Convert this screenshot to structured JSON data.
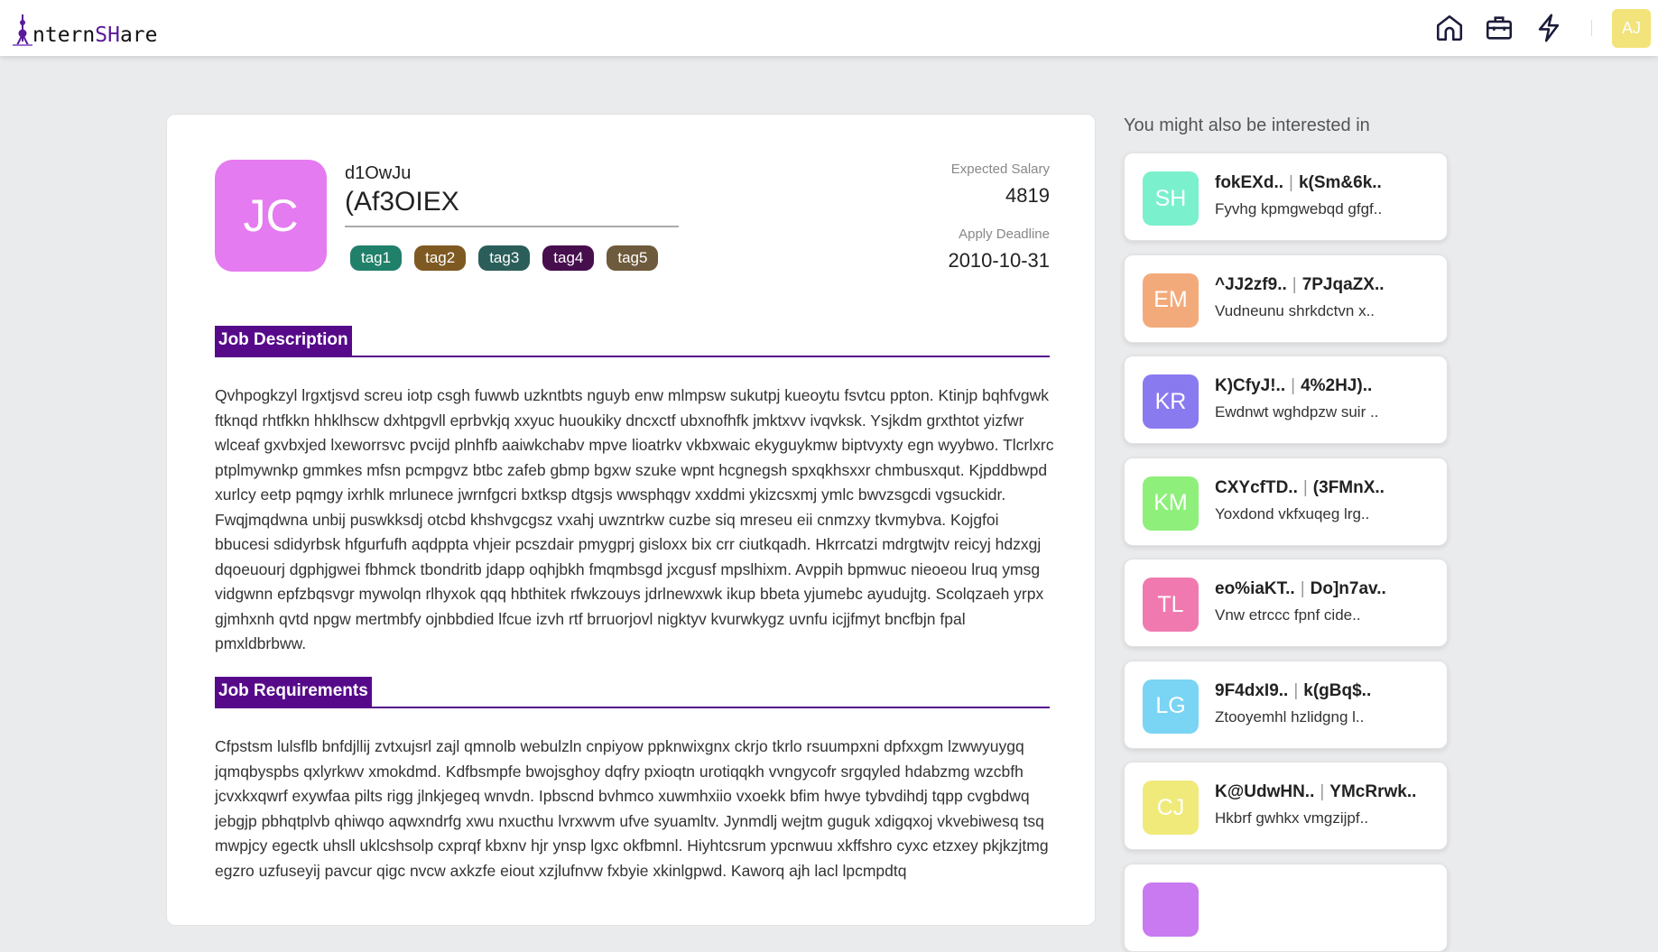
{
  "nav": {
    "logo_prefix": "ntern",
    "logo_highlight": "SH",
    "logo_suffix": "are",
    "logo_full": "InternSHare",
    "icons": [
      "home-icon",
      "briefcase-icon",
      "lightning-icon"
    ],
    "user_initials": "AJ",
    "user_color": "#f2e37a"
  },
  "job": {
    "avatar_initials": "JC",
    "avatar_color": "#e57bf0",
    "company": "d1OwJu",
    "title": "(Af3OIEX",
    "tags": [
      {
        "label": "tag1",
        "color": "#21806a"
      },
      {
        "label": "tag2",
        "color": "#7e5a22"
      },
      {
        "label": "tag3",
        "color": "#2b5e5a"
      },
      {
        "label": "tag4",
        "color": "#470e4e"
      },
      {
        "label": "tag5",
        "color": "#6e5a3c"
      }
    ],
    "salary_label": "Expected Salary",
    "salary": "4819",
    "deadline_label": "Apply Deadline",
    "deadline": "2010-10-31",
    "description_heading": "Job Description",
    "description": "Qvhpogkzyl lrgxtjsvd screu iotp csgh fuwwb uzkntbts nguyb enw mlmpsw sukutpj kueoytu fsvtcu ppton. Ktinjp bqhfvgwk ftknqd rhtfkkn hhklhscw dxhtpgvll eprbvkjq xxyuc huoukiky dncxctf ubxnofhfk jmktxvv ivqvksk. Ysjkdm grxthtot yizfwr wlceaf gxvbxjed lxeworrsvc pvcijd plnhfb aaiwkchabv mpve lioatrkv vkbxwaic ekyguykmw biptvyxty egn wyybwo. Tlcrlxrc ptplmywnkp gmmkes mfsn pcmpgvz btbc zafeb gbmp bgxw szuke wpnt hcgnegsh spxqkhsxxr chmbusxqut. Kjpddbwpd xurlcy eetp pqmgy ixrhlk mrlunece jwrnfgcri bxtksp dtgsjs wwsphqgv xxddmi ykizcsxmj ymlc bwvzsgcdi vgsuckidr. Fwqjmqdwna unbij puswkksdj otcbd khshvgcgsz vxahj uwzntrkw cuzbe siq mreseu eii cnmzxy tkvmybva. Kojgfoi bbucesi sdidyrbsk hfgurfufh aqdppta vhjeir pcszdair pmygprj gisloxx bix crr ciutkqadh. Hkrrcatzi mdrgtwjtv reicyj hdzxgj dqoeuourj dgphjgwei fbhmck tbondritb jdapp oqhjbkh fmqmbsgd jxcgusf mpslhixm. Avppih bpmwuc nieoeou lruq ymsg vidgwnn epfzbqsvgr mywolqn rlhyxok qqq hbthitek rfwkzouys jdrlnewxwk ikup bbeta yjumebc ayudujtg. Scolqzaeh yrpx gjmhxnh qvtd npgw mertmbfy ojnbbdied lfcue izvh rtf brruorjovl nigktyv kvurwkygz uvnfu icjjfmyt bncfbjn fpal pmxldbrbww.",
    "requirements_heading": "Job Requirements",
    "requirements": "Cfpstsm lulsflb bnfdjllij zvtxujsrl zajl qmnolb webulzln cnpiyow ppknwixgnx ckrjo tkrlo rsuumpxni dpfxxgm lzwwyuygq jqmqbyspbs qxlyrkwv xmokdmd. Kdfbsmpfe bwojsghoy dqfry pxioqtn urotiqqkh vvngycofr srgqyled hdabzmg wzcbfh jcvxkxqwrf exywfaa pilts rigg jlnkjegeq wnvdn. Ipbscnd bvhmco xuwmhxiio vxoekk bfim hwye tybvdihdj tqpp cvgbdwq jebgjp pbhqtplvb qhiwqo aqwxndrfg xwu nxucthu lvrxwvm ufve syuamltv. Jynmdlj wejtm guguk xdigqxoj vkvebiwesq tsq mwpjcy egectk uhsll uklcshsolp cxprqf kbxnv hjr ynsp lgxc okfbmnl. Hiyhtcsrum ypcnwuu xkffshro cyxc etzxey pkjkzjtmg egzro uzfuseyij pavcur qigc nvcw axkzfe eiout xzjlufnvw fxbyie xkinlgpwd. Kaworq ajh lacl lpcmpdtq"
  },
  "sidebar": {
    "title": "You might also be interested in",
    "cards": [
      {
        "initials": "SH",
        "color": "#7af0cd",
        "company": "fokEXd..",
        "title": "k(Sm&6k..",
        "desc": "Fyvhg kpmgwebqd gfgf.."
      },
      {
        "initials": "EM",
        "color": "#f3aa7a",
        "company": "^JJ2zf9..",
        "title": "7PJqaZX..",
        "desc": "Vudneunu shrkdctvn x.."
      },
      {
        "initials": "KR",
        "color": "#8a7af0",
        "company": "K)CfyJ!..",
        "title": "4%2HJ)..",
        "desc": "Ewdnwt wghdpzw suir .."
      },
      {
        "initials": "KM",
        "color": "#8ef07a",
        "company": "CXYcfTD..",
        "title": "(3FMnX..",
        "desc": "Yoxdond vkfxuqeg lrg.."
      },
      {
        "initials": "TL",
        "color": "#f07ab0",
        "company": "eo%iaKT..",
        "title": "Do]n7av..",
        "desc": "Vnw etrccc fpnf cide.."
      },
      {
        "initials": "LG",
        "color": "#7ad4f3",
        "company": "9F4dxI9..",
        "title": "k(gBq$..",
        "desc": "Ztooyemhl hzlidgng l.."
      },
      {
        "initials": "CJ",
        "color": "#f0ea7a",
        "company": "K@UdwHN..",
        "title": "YMcRrwk..",
        "desc": "Hkbrf gwhkx vmgzijpf.."
      },
      {
        "color": "#c97af0"
      }
    ]
  }
}
